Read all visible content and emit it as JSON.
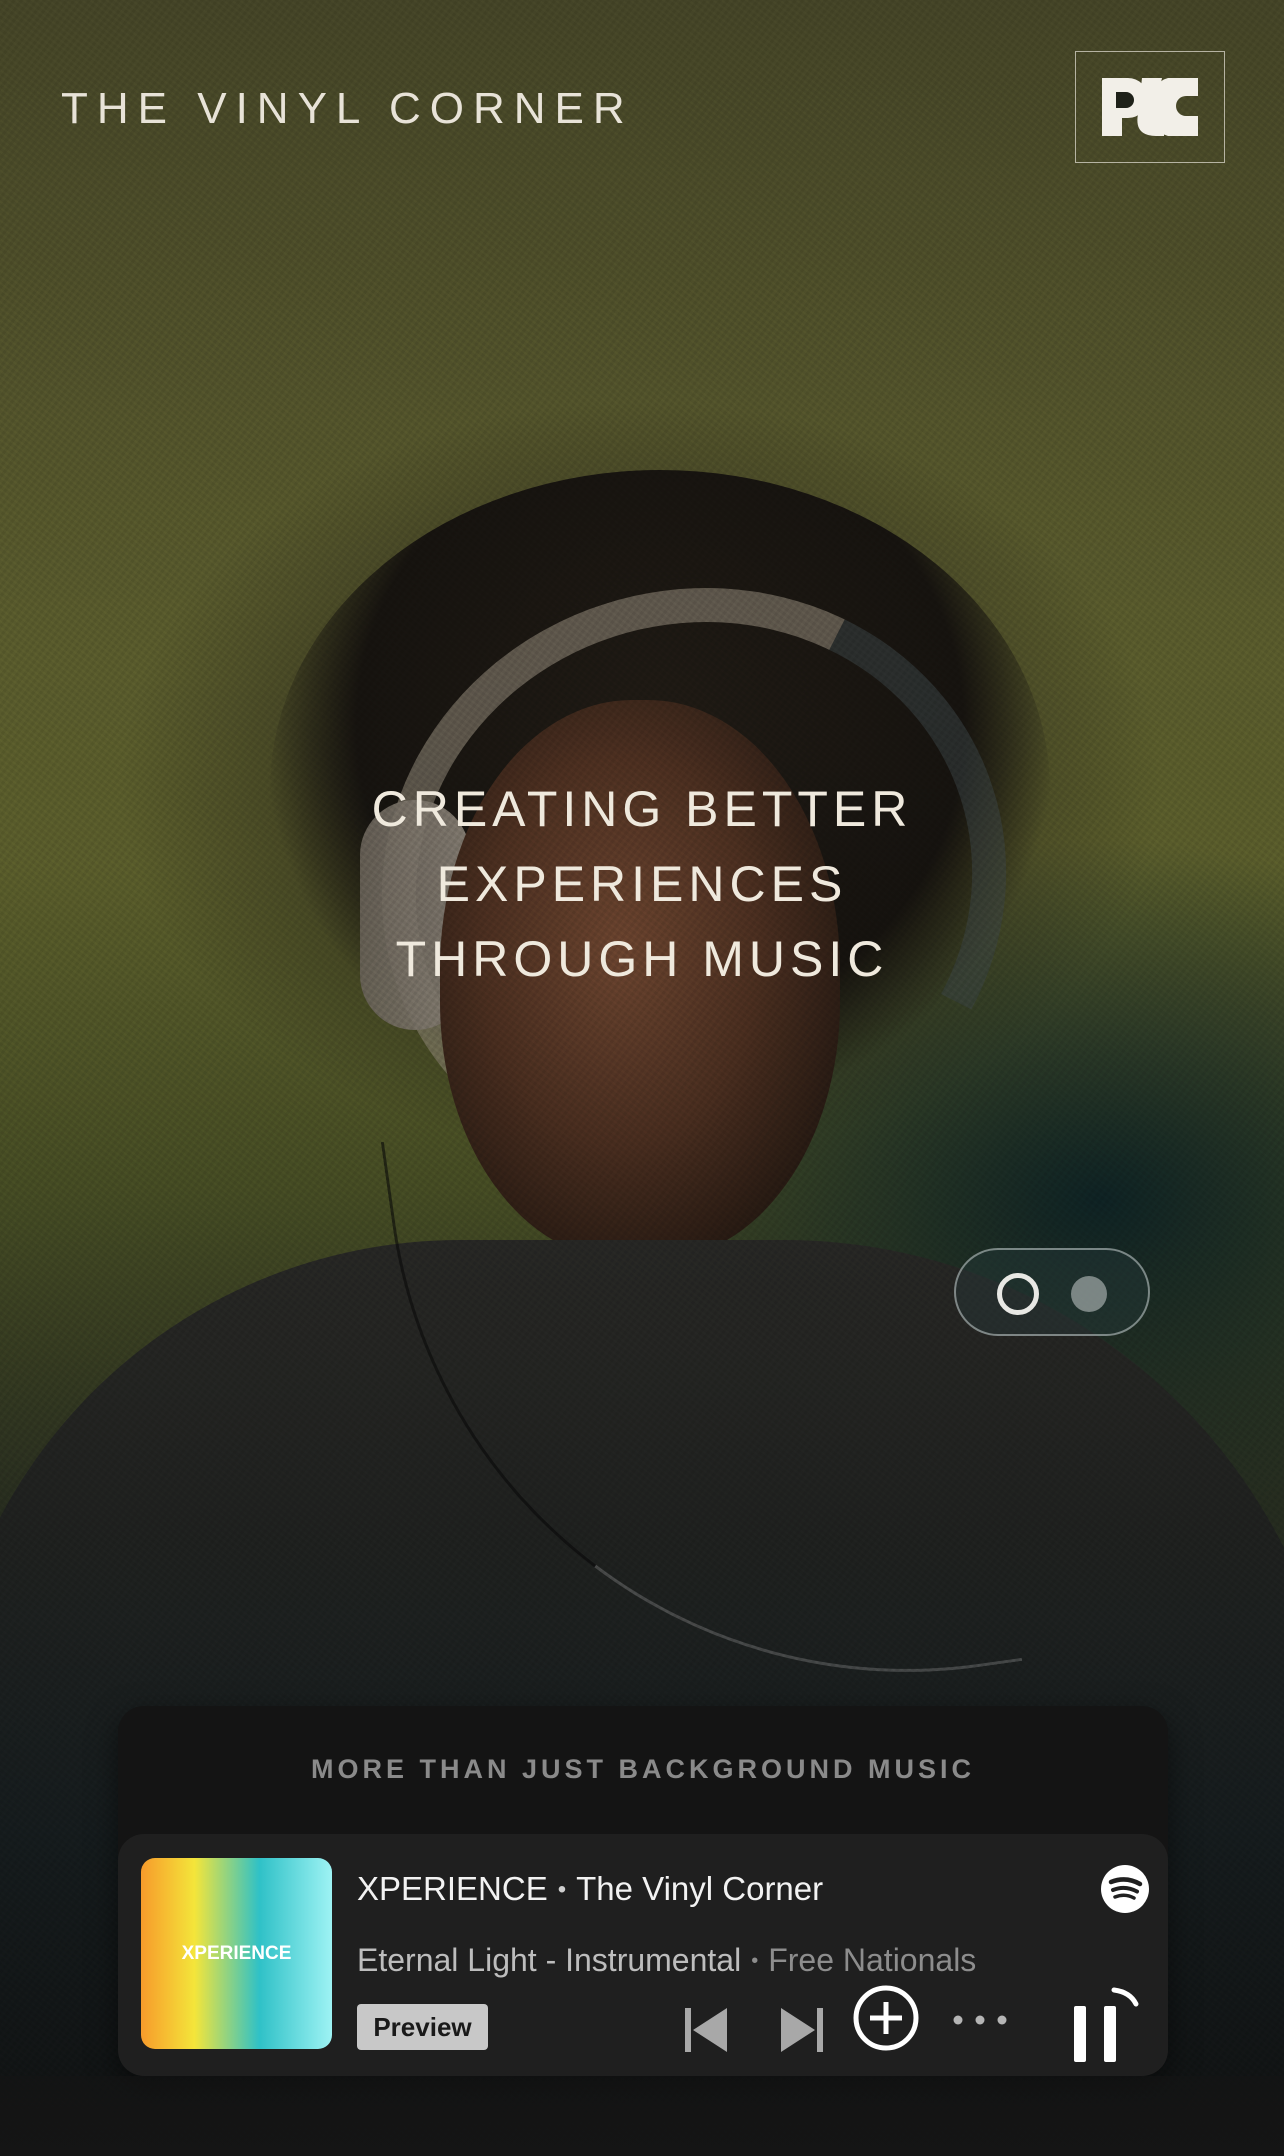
{
  "header": {
    "brand": "THE VINYL CORNER",
    "logo_icon": "vc-monogram-icon"
  },
  "hero": {
    "headline_lines": [
      "CREATING BETTER",
      "EXPERIENCES",
      "THROUGH MUSIC"
    ]
  },
  "slider": {
    "total": 2,
    "active_index": 0
  },
  "player": {
    "tagline": "MORE THAN JUST BACKGROUND MUSIC",
    "album_art_text": "XPERIENCE",
    "playlist": "XPERIENCE",
    "owner": "The Vinyl Corner",
    "track": "Eternal Light - Instrumental",
    "artist": "Free Nationals",
    "preview_label": "Preview",
    "icons": {
      "service": "spotify-icon",
      "prev": "skip-previous-icon",
      "next": "skip-next-icon",
      "add": "add-circle-icon",
      "more": "more-horizontal-icon",
      "pause": "pause-icon"
    },
    "colors": {
      "card": "#141414",
      "player": "#1f1f1f",
      "preview_bg": "#c8c8c8"
    }
  }
}
